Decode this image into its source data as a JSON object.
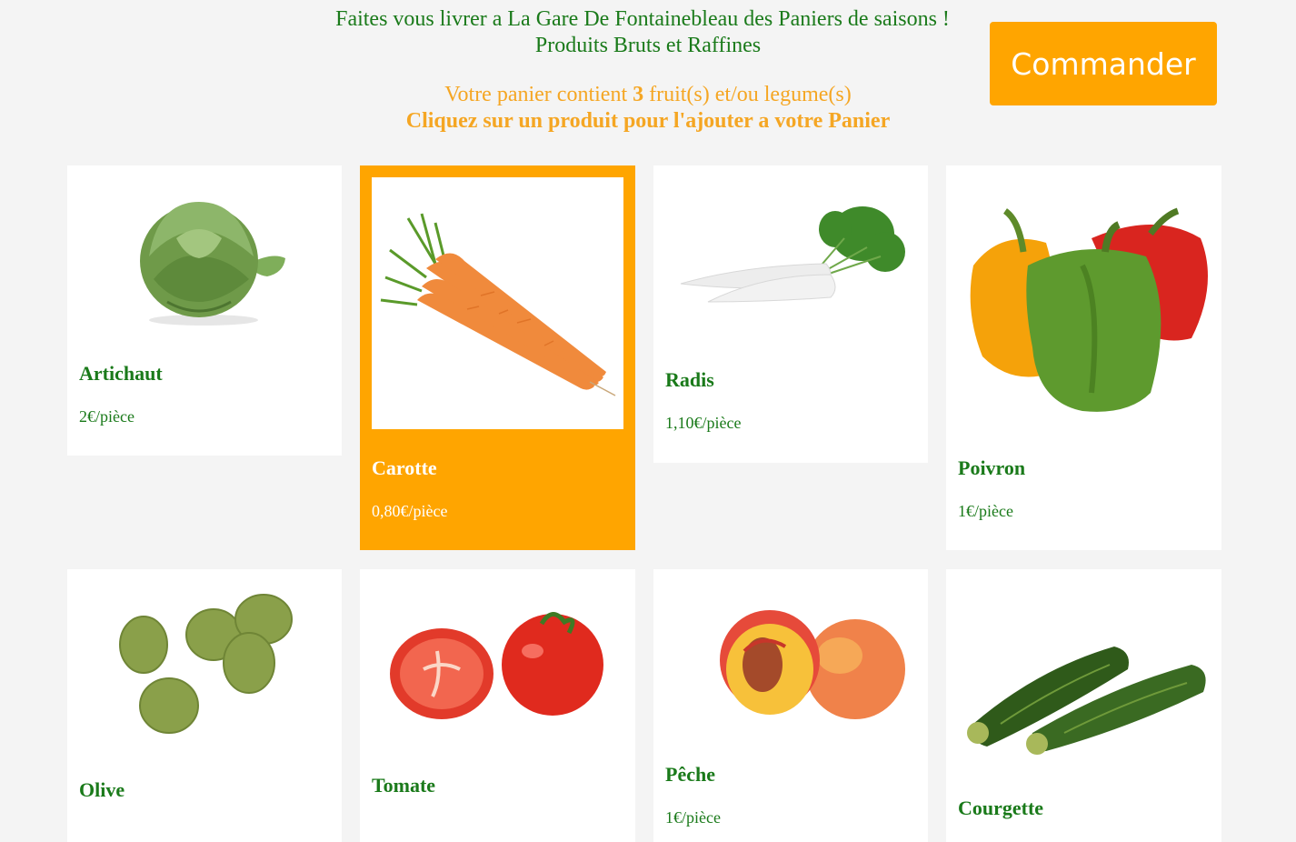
{
  "header": {
    "line1": "Faites vous livrer a La Gare De Fontainebleau des Paniers de saisons !",
    "line2": "Produits Bruts et Raffines",
    "basket_prefix": "Votre panier contient ",
    "basket_count": "3",
    "basket_suffix": " fruit(s) et/ou legume(s)",
    "instruction": "Cliquez sur un produit pour l'ajouter a votre Panier"
  },
  "order_button": {
    "label": "Commander"
  },
  "products": [
    {
      "name": "Artichaut",
      "price": "2€/pièce",
      "selected": false
    },
    {
      "name": "Carotte",
      "price": "0,80€/pièce",
      "selected": true
    },
    {
      "name": "Radis",
      "price": "1,10€/pièce",
      "selected": false
    },
    {
      "name": "Poivron",
      "price": "1€/pièce",
      "selected": false
    },
    {
      "name": "Olive",
      "price": "",
      "selected": false
    },
    {
      "name": "Tomate",
      "price": "",
      "selected": false
    },
    {
      "name": "Pêche",
      "price": "1€/pièce",
      "selected": false
    },
    {
      "name": "Courgette",
      "price": "",
      "selected": false
    }
  ],
  "colors": {
    "green": "#1a7a1a",
    "orange": "#ffa500",
    "background": "#f4f4f4"
  }
}
